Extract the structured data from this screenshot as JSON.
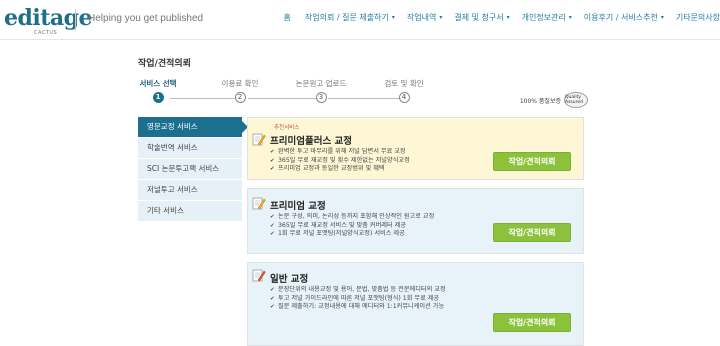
{
  "header": {
    "logo_text": "editage",
    "logo_sub": "CACTUS",
    "tagline": "Helping you get published",
    "nav": [
      {
        "label": "홈",
        "has_dropdown": false
      },
      {
        "label": "작업의뢰 / 질문 제출하기",
        "has_dropdown": true
      },
      {
        "label": "작업내역",
        "has_dropdown": true
      },
      {
        "label": "결제 및 청구서",
        "has_dropdown": true
      },
      {
        "label": "개인정보관리",
        "has_dropdown": true
      },
      {
        "label": "이용후기 / 서비스추천",
        "has_dropdown": true
      },
      {
        "label": "기타문의사항",
        "has_dropdown": false
      }
    ]
  },
  "page": {
    "title": "작업/견적의뢰"
  },
  "steps": [
    {
      "label": "서비스 선택",
      "number": "1",
      "active": true
    },
    {
      "label": "이용료 확인",
      "number": "2",
      "active": false
    },
    {
      "label": "논문원고 업로드",
      "number": "3",
      "active": false
    },
    {
      "label": "검토 및 확인",
      "number": "4",
      "active": false
    }
  ],
  "quality": {
    "label": "100% 품질보증",
    "badge": "Quality Assured"
  },
  "sidebar": {
    "items": [
      {
        "label": "영문교정 서비스",
        "active": true
      },
      {
        "label": "학술번역 서비스",
        "active": false
      },
      {
        "label": "SCI 논문투고팩 서비스",
        "active": false
      },
      {
        "label": "저널투고 서비스",
        "active": false
      },
      {
        "label": "기타 서비스",
        "active": false
      }
    ]
  },
  "cards": [
    {
      "kicker": "추천서비스",
      "title": "프리미엄플러스 교정",
      "bullets": [
        "완벽한 투고 마무리를 위해 저널 답변서 무료 교정",
        "365일 무료 재교정 및 횟수 제한없는 저널양식교정",
        "프리미엄 교정과 동일한 교정범위 및 혜택"
      ],
      "button": "작업/견적의뢰"
    },
    {
      "kicker": "",
      "title": "프리미엄 교정",
      "bullets": [
        "논문 구성, 의미, 논리성 등까지 포함해 인상적인 원고로 교정",
        "365일 무료 재교정 서비스 및 맞춤 커버레터 제공",
        "1회 무료 저널 포맷팅(저널양식교정) 서비스 제공"
      ],
      "button": "작업/견적의뢰"
    },
    {
      "kicker": "",
      "title": "일반 교정",
      "bullets": [
        "문장단위의 내용교정 및 용어, 문법, 맞춤법 등 전문에디터의 교정",
        "투고 저널 가이드라인에 따른 저널 포맷팅(형식) 1회 무료 제공",
        "질문 제출하기: 교정내용에 대해 에디터와 1:1커뮤니케이션 가능"
      ],
      "button": "작업/견적의뢰"
    }
  ],
  "colors": {
    "brand": "#1d6f8f",
    "button_green": "#8cc23b",
    "highlight_card": "#fdf7d5",
    "card_blue": "#e8f3f9",
    "kicker_red": "#d0543c"
  }
}
